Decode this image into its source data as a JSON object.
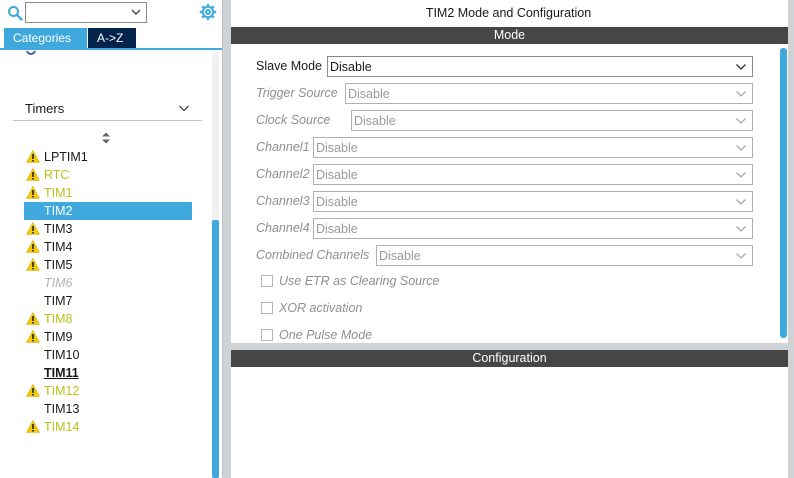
{
  "left": {
    "search": {
      "value": ""
    },
    "tabs": [
      {
        "label": "Categories",
        "active": true
      },
      {
        "label": "A->Z",
        "active": false
      }
    ],
    "group": {
      "title": "Timers"
    },
    "peripherals": [
      {
        "label": "LPTIM1",
        "status": "warning",
        "text_style": "normal"
      },
      {
        "label": "RTC",
        "status": "warning",
        "text_style": "warning"
      },
      {
        "label": "TIM1",
        "status": "warning",
        "text_style": "warning"
      },
      {
        "label": "TIM2",
        "status": "none",
        "text_style": "selected"
      },
      {
        "label": "TIM3",
        "status": "warning",
        "text_style": "normal"
      },
      {
        "label": "TIM4",
        "status": "warning",
        "text_style": "normal"
      },
      {
        "label": "TIM5",
        "status": "warning",
        "text_style": "normal"
      },
      {
        "label": "TIM6",
        "status": "none",
        "text_style": "disabled"
      },
      {
        "label": "TIM7",
        "status": "none",
        "text_style": "normal"
      },
      {
        "label": "TIM8",
        "status": "warning",
        "text_style": "warning"
      },
      {
        "label": "TIM9",
        "status": "warning",
        "text_style": "normal"
      },
      {
        "label": "TIM10",
        "status": "none",
        "text_style": "normal"
      },
      {
        "label": "TIM11",
        "status": "none",
        "text_style": "bold"
      },
      {
        "label": "TIM12",
        "status": "warning",
        "text_style": "warning"
      },
      {
        "label": "TIM13",
        "status": "none",
        "text_style": "normal"
      },
      {
        "label": "TIM14",
        "status": "warning",
        "text_style": "warning"
      }
    ]
  },
  "right": {
    "title": "TIM2 Mode and Configuration",
    "mode_header": "Mode",
    "config_header": "Configuration",
    "fields": [
      {
        "label": "Slave Mode",
        "value": "Disable",
        "enabled": true
      },
      {
        "label": "Trigger Source",
        "value": "Disable",
        "enabled": false
      },
      {
        "label": "Clock Source",
        "value": "Disable",
        "enabled": false
      },
      {
        "label": "Channel1",
        "value": "Disable",
        "enabled": false
      },
      {
        "label": "Channel2",
        "value": "Disable",
        "enabled": false
      },
      {
        "label": "Channel3",
        "value": "Disable",
        "enabled": false
      },
      {
        "label": "Channel4",
        "value": "Disable",
        "enabled": false
      },
      {
        "label": "Combined Channels",
        "value": "Disable",
        "enabled": false
      }
    ],
    "checkboxes": [
      {
        "label": "Use ETR as Clearing Source",
        "checked": false
      },
      {
        "label": "XOR activation",
        "checked": false
      },
      {
        "label": "One Pulse Mode",
        "checked": false
      }
    ]
  },
  "colors": {
    "accent": "#3fa9dd",
    "tab_dark": "#03234b",
    "header_bar": "#464646",
    "warning_text": "#b9c21a",
    "warning_icon": "#f2c811"
  }
}
